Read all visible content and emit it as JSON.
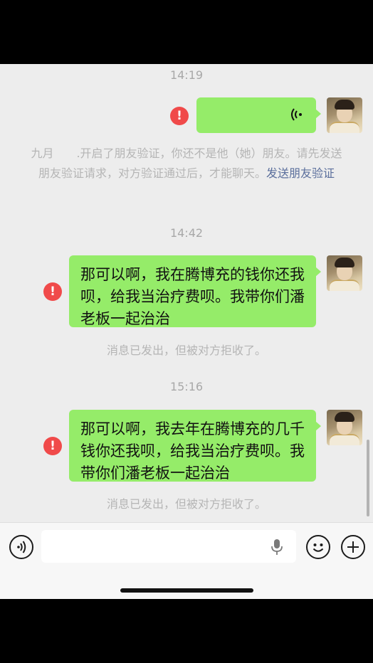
{
  "chat": {
    "messages": [
      {
        "timestamp": "14:19",
        "status_icon": "error-exclamation-icon"
      },
      {
        "system_notice": {
          "text": "九月　　.开启了朋友验证，你还不是他（她）朋友。请先发送朋友验证请求，对方验证通过后，才能聊天。",
          "link": "发送朋友验证"
        }
      },
      {
        "timestamp": "14:42",
        "text": "那可以啊，我在腾博充的钱你还我呗，给我当治疗费呗。我带你们潘老板一起治治",
        "status_icon": "error-exclamation-icon",
        "footer": "消息已发出，但被对方拒收了。"
      },
      {
        "timestamp": "15:16",
        "text": "那可以啊，我去年在腾博充的几千钱你还我呗，给我当治疗费呗。我带你们潘老板一起治治",
        "status_icon": "error-exclamation-icon",
        "footer": "消息已发出，但被对方拒收了。"
      }
    ]
  },
  "input_bar": {
    "voice_toggle_icon": "voice-mode-icon",
    "mic_icon": "microphone-icon",
    "emoji_icon": "emoji-smile-icon",
    "plus_icon": "plus-icon"
  },
  "colors": {
    "bubble": "#95ec69",
    "error": "#f04a4a",
    "link": "#5b6f9c",
    "background": "#ededed"
  }
}
